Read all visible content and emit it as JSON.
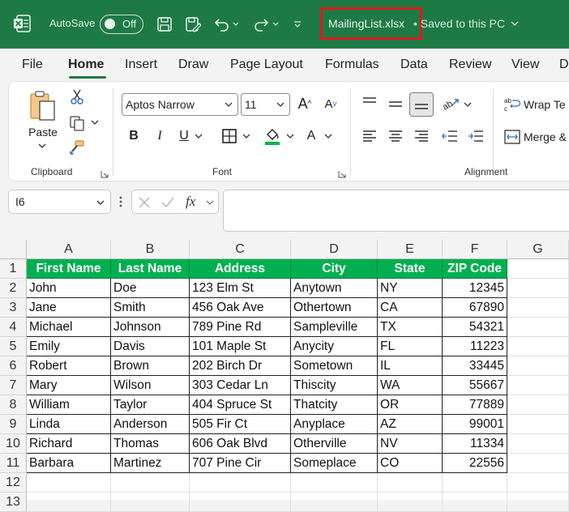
{
  "titlebar": {
    "autosave_label": "AutoSave",
    "autosave_state": "Off",
    "filename": "MailingList.xlsx",
    "saved_status": "• Saved to this PC",
    "accent_color": "#1e7a45"
  },
  "tabs": [
    "File",
    "Home",
    "Insert",
    "Draw",
    "Page Layout",
    "Formulas",
    "Data",
    "Review",
    "View",
    "D"
  ],
  "active_tab": "Home",
  "ribbon": {
    "clipboard": {
      "paste_label": "Paste",
      "group_label": "Clipboard"
    },
    "font": {
      "font_name": "Aptos Narrow",
      "font_size": "11",
      "group_label": "Font"
    },
    "alignment": {
      "wrap_label": "Wrap Te",
      "merge_label": "Merge &",
      "group_label": "Alignment"
    }
  },
  "formula_bar": {
    "name_box": "I6",
    "fx_label": "fx",
    "formula": ""
  },
  "sheet": {
    "columns": [
      "A",
      "B",
      "C",
      "D",
      "E",
      "F",
      "G"
    ],
    "rows": [
      "1",
      "2",
      "3",
      "4",
      "5",
      "6",
      "7",
      "8",
      "9",
      "10",
      "11",
      "12",
      "13"
    ],
    "header": [
      "First Name",
      "Last Name",
      "Address",
      "City",
      "State",
      "ZIP Code"
    ],
    "header_color": "#00b050",
    "data": [
      [
        "John",
        "Doe",
        "123 Elm St",
        "Anytown",
        "NY",
        "12345"
      ],
      [
        "Jane",
        "Smith",
        "456 Oak Ave",
        "Othertown",
        "CA",
        "67890"
      ],
      [
        "Michael",
        "Johnson",
        "789 Pine Rd",
        "Sampleville",
        "TX",
        "54321"
      ],
      [
        "Emily",
        "Davis",
        "101 Maple St",
        "Anycity",
        "FL",
        "11223"
      ],
      [
        "Robert",
        "Brown",
        "202 Birch Dr",
        "Sometown",
        "IL",
        "33445"
      ],
      [
        "Mary",
        "Wilson",
        "303 Cedar Ln",
        "Thiscity",
        "WA",
        "55667"
      ],
      [
        "William",
        "Taylor",
        "404 Spruce St",
        "Thatcity",
        "OR",
        "77889"
      ],
      [
        "Linda",
        "Anderson",
        "505 Fir Ct",
        "Anyplace",
        "AZ",
        "99001"
      ],
      [
        "Richard",
        "Thomas",
        "606 Oak Blvd",
        "Otherville",
        "NV",
        "11334"
      ],
      [
        "Barbara",
        "Martinez",
        "707 Pine Cir",
        "Someplace",
        "CO",
        "22556"
      ]
    ]
  }
}
